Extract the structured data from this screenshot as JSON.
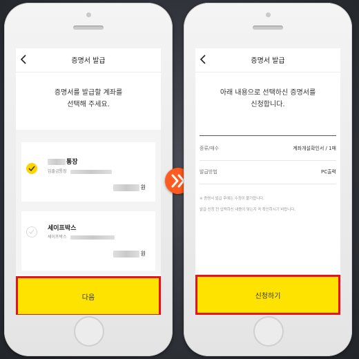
{
  "left_screen": {
    "nav_title": "증명서 발급",
    "heading_line1": "증명서를 발급할 계좌를",
    "heading_line2": "선택해 주세요.",
    "accounts": [
      {
        "name": "통장",
        "subtitle": "입출금통장",
        "currency": "원",
        "selected": true
      },
      {
        "name": "세이프박스",
        "subtitle": "세이프박스",
        "currency": "원",
        "selected": false
      }
    ],
    "next_button": "다음"
  },
  "right_screen": {
    "nav_title": "증명서 발급",
    "heading_line1": "아래 내용으로 선택하신 증명서를",
    "heading_line2": "신청합니다.",
    "rows": [
      {
        "label": "종류/매수",
        "value": "계좌개설확인서 / 1매"
      },
      {
        "label": "발급방법",
        "value": "PC출력"
      }
    ],
    "note1": "※ 증명서 발급 후에는 수정이 불가합니다.",
    "note2": "발급 신청 전 입력하신 내용이 맞는지 꼭 확인하시기 바랍니다.",
    "apply_button": "신청하기"
  },
  "icons": {
    "back": "chevron-left-icon",
    "check": "check-icon",
    "next_arrow": "double-chevron-right-icon"
  },
  "colors": {
    "cta_yellow": "#ffe300",
    "highlight_red": "#e8121b",
    "check_yellow": "#ffd400",
    "arrow_orange": "#ff5a1f"
  }
}
